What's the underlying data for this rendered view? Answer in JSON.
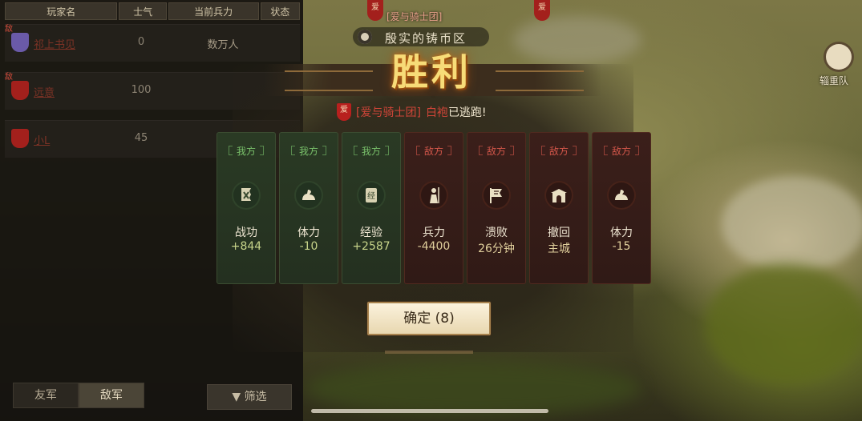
{
  "list": {
    "headers": {
      "name": "玩家名",
      "morale": "士气",
      "troops": "当前兵力",
      "status": "状态"
    },
    "rows": [
      {
        "tag": "敌",
        "name": "祁上书见",
        "morale": "0",
        "troops": "数万人",
        "icon_color": "#6a5aa8"
      },
      {
        "tag": "敌",
        "name": "远意",
        "morale": "100",
        "troops": "",
        "icon_color": "#a3201c"
      },
      {
        "tag": "",
        "name": "小L",
        "morale": "45",
        "troops": "",
        "icon_color": "#a3201c"
      }
    ],
    "tabs": {
      "friendly": "友军",
      "enemy": "敌军"
    },
    "filter": "筛选"
  },
  "map": {
    "top_flag_1": "爱",
    "top_flag_2": "爱",
    "alliance_top": "[爱与骑士团]",
    "region": "殷实的铸币区",
    "supply_label": "辎重队"
  },
  "result": {
    "title": "胜利",
    "escape": {
      "shield": "爱",
      "alliance": "[爱与骑士团]",
      "name": "白袍",
      "text": "已逃跑!"
    },
    "cards": [
      {
        "side": "我方",
        "label": "战功",
        "value": "+844",
        "icon": "merit-icon"
      },
      {
        "side": "我方",
        "label": "体力",
        "value": "-10",
        "icon": "stamina-icon"
      },
      {
        "side": "我方",
        "label": "经验",
        "value": "+2587",
        "icon": "experience-icon"
      },
      {
        "side": "敌方",
        "label": "兵力",
        "value": "-4400",
        "icon": "soldier-icon"
      },
      {
        "side": "敌方",
        "label": "溃败",
        "value": "26分钟",
        "icon": "rout-flag-icon"
      },
      {
        "side": "敌方",
        "label": "撤回",
        "value": "主城",
        "icon": "city-gate-icon"
      },
      {
        "side": "敌方",
        "label": "体力",
        "value": "-15",
        "icon": "stamina-icon"
      }
    ],
    "confirm": "确定 (8)"
  }
}
